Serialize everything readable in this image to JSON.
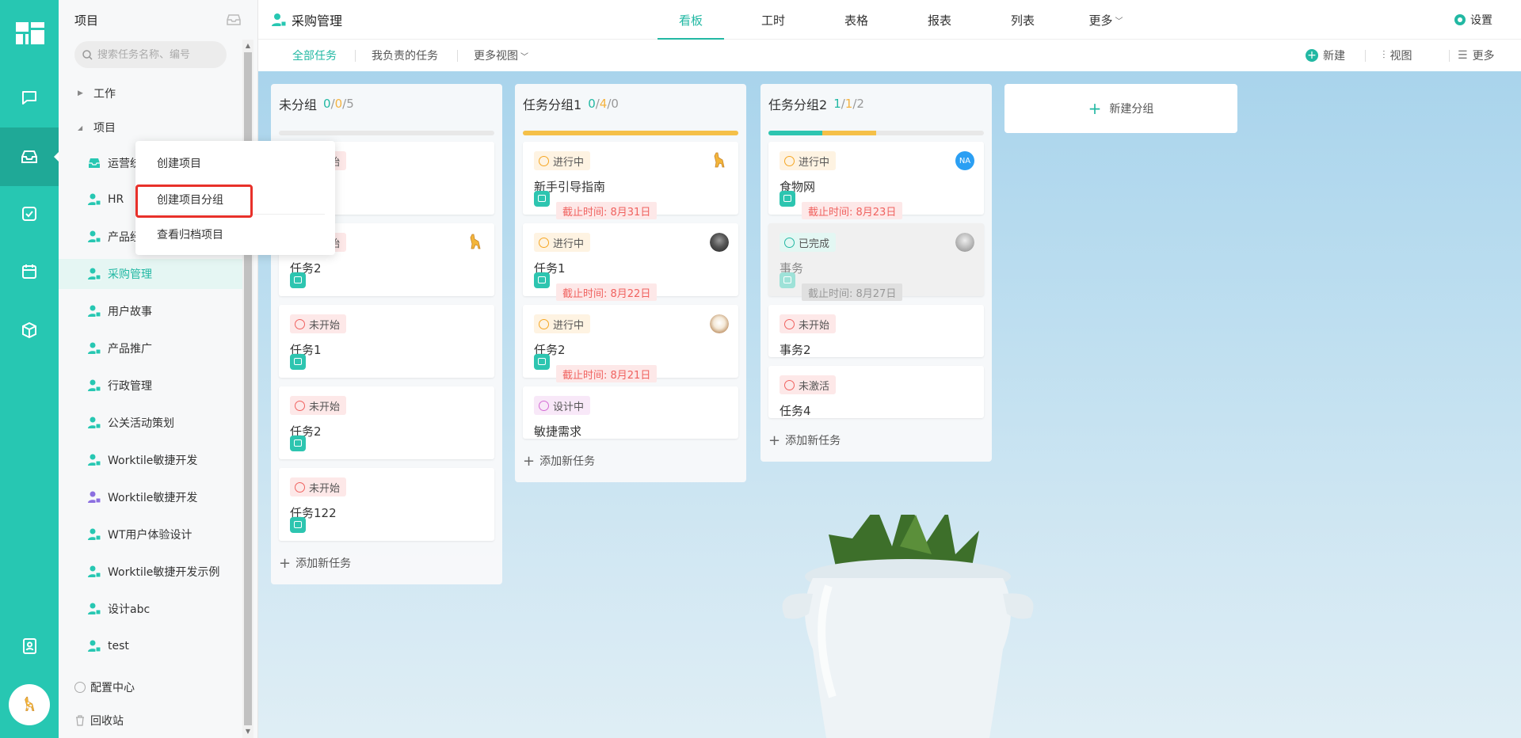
{
  "sidebar": {
    "title": "项目",
    "search_placeholder": "搜索任务名称、编号",
    "work_label": "工作",
    "projects_label": "项目",
    "projects": [
      {
        "name": "运营统",
        "icon": "inbox-icon",
        "color": "#27c7b2"
      },
      {
        "name": "HR",
        "icon": "user-project-icon",
        "color": "#27c7b2"
      },
      {
        "name": "产品经",
        "icon": "user-project-icon",
        "color": "#27c7b2"
      },
      {
        "name": "采购管理",
        "icon": "user-project-icon",
        "color": "#27c7b2",
        "active": true
      },
      {
        "name": "用户故事",
        "icon": "user-project-icon",
        "color": "#27c7b2"
      },
      {
        "name": "产品推广",
        "icon": "user-project-icon",
        "color": "#27c7b2"
      },
      {
        "name": "行政管理",
        "icon": "user-project-icon",
        "color": "#27c7b2"
      },
      {
        "name": "公关活动策划",
        "icon": "user-project-icon",
        "color": "#27c7b2"
      },
      {
        "name": "Worktile敏捷开发",
        "icon": "user-project-icon",
        "color": "#27c7b2"
      },
      {
        "name": "Worktile敏捷开发",
        "icon": "user-project-icon",
        "color": "#8b6fe0"
      },
      {
        "name": "WT用户体验设计",
        "icon": "user-project-icon",
        "color": "#27c7b2"
      },
      {
        "name": "Worktile敏捷开发示例",
        "icon": "user-project-icon",
        "color": "#27c7b2"
      },
      {
        "name": "设计abc",
        "icon": "user-project-icon",
        "color": "#27c7b2"
      },
      {
        "name": "test",
        "icon": "user-project-icon",
        "color": "#27c7b2"
      }
    ],
    "config_label": "配置中心",
    "trash_label": "回收站"
  },
  "context_menu": {
    "items": [
      "创建项目",
      "创建项目分组",
      "查看归档项目"
    ],
    "highlighted": "创建项目分组"
  },
  "topbar": {
    "project_title": "采购管理",
    "tabs": [
      "看板",
      "工时",
      "表格",
      "报表",
      "列表",
      "更多"
    ],
    "active_tab": "看板",
    "settings_label": "设置"
  },
  "subbar": {
    "views": [
      "全部任务",
      "我负责的任务",
      "更多视图"
    ],
    "active_view": "全部任务",
    "new_label": "新建",
    "view_label": "视图",
    "more_label": "更多"
  },
  "board": {
    "add_task_label": "添加新任务",
    "new_group_label": "新建分组",
    "columns": [
      {
        "title": "未分组",
        "counts": [
          "0",
          "0",
          "5"
        ],
        "progress": {
          "done": 0,
          "in_progress": 0
        },
        "cards": [
          {
            "status": "未开始",
            "status_type": "red",
            "title": "",
            "deadline": "",
            "avatar": ""
          },
          {
            "status": "未开始",
            "status_type": "red",
            "title": "任务2",
            "deadline": "",
            "avatar": "giraffe"
          },
          {
            "status": "未开始",
            "status_type": "red",
            "title": "任务1",
            "deadline": "",
            "avatar": ""
          },
          {
            "status": "未开始",
            "status_type": "red",
            "title": "任务2",
            "deadline": "",
            "avatar": ""
          },
          {
            "status": "未开始",
            "status_type": "red",
            "title": "任务122",
            "deadline": "",
            "avatar": ""
          }
        ]
      },
      {
        "title": "任务分组1",
        "counts": [
          "0",
          "4",
          "0"
        ],
        "progress": {
          "done": 0,
          "in_progress": 1
        },
        "cards": [
          {
            "status": "进行中",
            "status_type": "orange",
            "title": "新手引导指南",
            "deadline": "截止时间: 8月31日",
            "avatar": "giraffe"
          },
          {
            "status": "进行中",
            "status_type": "orange",
            "title": "任务1",
            "deadline": "截止时间: 8月22日",
            "avatar": "photo-dark"
          },
          {
            "status": "进行中",
            "status_type": "orange",
            "title": "任务2",
            "deadline": "截止时间: 8月21日",
            "avatar": "photo-cartoon"
          },
          {
            "status": "设计中",
            "status_type": "purple",
            "title": "敏捷需求",
            "deadline": "",
            "avatar": ""
          }
        ]
      },
      {
        "title": "任务分组2",
        "counts": [
          "1",
          "1",
          "2"
        ],
        "progress": {
          "done": 0.25,
          "in_progress": 0.25
        },
        "cards": [
          {
            "status": "进行中",
            "status_type": "orange",
            "title": "食物网",
            "deadline": "截止时间: 8月23日",
            "avatar": "NA"
          },
          {
            "status": "已完成",
            "status_type": "green",
            "title": "事务",
            "deadline": "截止时间: 8月27日",
            "avatar": "photo-gray",
            "done": true
          },
          {
            "status": "未开始",
            "status_type": "red",
            "title": "事务2",
            "deadline": "",
            "avatar": ""
          },
          {
            "status": "未激活",
            "status_type": "red",
            "title": "任务4",
            "deadline": "",
            "avatar": ""
          }
        ]
      }
    ]
  },
  "colors": {
    "accent": "#22b8a3",
    "rail": "#27c7b2",
    "danger": "#f0625f",
    "warning": "#f5b340"
  }
}
